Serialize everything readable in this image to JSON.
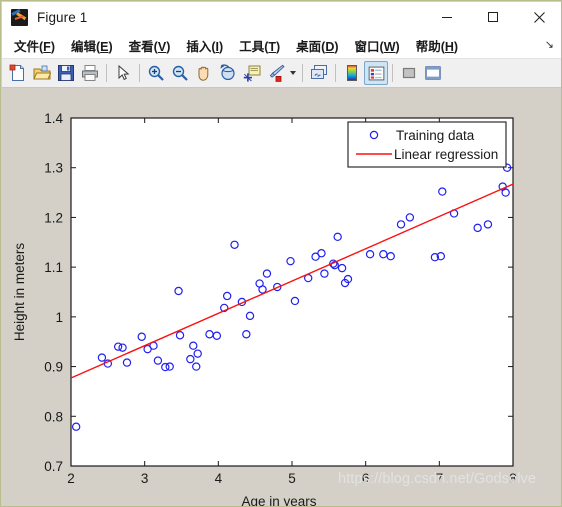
{
  "window": {
    "title": "Figure 1",
    "app_icon": "matlab-icon",
    "controls": {
      "minimize": "minimize-icon",
      "maximize": "maximize-icon",
      "close": "close-icon"
    }
  },
  "menubar": {
    "items": [
      {
        "name": "file",
        "label": "文件(F)",
        "text": "文件(",
        "accel": "F",
        "tail": ")"
      },
      {
        "name": "edit",
        "label": "编辑(E)",
        "text": "编辑(",
        "accel": "E",
        "tail": ")"
      },
      {
        "name": "view",
        "label": "查看(V)",
        "text": "查看(",
        "accel": "V",
        "tail": ")"
      },
      {
        "name": "insert",
        "label": "插入(I)",
        "text": "插入(",
        "accel": "I",
        "tail": ")"
      },
      {
        "name": "tools",
        "label": "工具(T)",
        "text": "工具(",
        "accel": "T",
        "tail": ")"
      },
      {
        "name": "desktop",
        "label": "桌面(D)",
        "text": "桌面(",
        "accel": "D",
        "tail": ")"
      },
      {
        "name": "window",
        "label": "窗口(W)",
        "text": "窗口(",
        "accel": "W",
        "tail": ")"
      },
      {
        "name": "help",
        "label": "帮助(H)",
        "text": "帮助(",
        "accel": "H",
        "tail": ")"
      }
    ],
    "overflow_glyph": "↘"
  },
  "toolbar": {
    "buttons": [
      {
        "name": "new-figure-icon",
        "type": "new"
      },
      {
        "name": "open-file-icon",
        "type": "open"
      },
      {
        "name": "save-figure-icon",
        "type": "save"
      },
      {
        "name": "print-figure-icon",
        "type": "print"
      },
      {
        "name": "separator",
        "type": "sep"
      },
      {
        "name": "pointer-select-icon",
        "type": "pointer"
      },
      {
        "name": "separator",
        "type": "sep"
      },
      {
        "name": "zoom-in-icon",
        "type": "zoomin"
      },
      {
        "name": "zoom-out-icon",
        "type": "zoomout"
      },
      {
        "name": "pan-hand-icon",
        "type": "pan"
      },
      {
        "name": "rotate-3d-icon",
        "type": "rotate"
      },
      {
        "name": "data-cursor-icon",
        "type": "datacursor"
      },
      {
        "name": "brush-data-icon",
        "type": "brush"
      },
      {
        "name": "brush-dropdown-arrow",
        "type": "dropdown"
      },
      {
        "name": "separator",
        "type": "sep"
      },
      {
        "name": "link-plot-icon",
        "type": "link"
      },
      {
        "name": "separator",
        "type": "sep"
      },
      {
        "name": "colorbar-icon",
        "type": "colorbar"
      },
      {
        "name": "legend-icon",
        "type": "legend",
        "pressed": true
      },
      {
        "name": "separator",
        "type": "sep"
      },
      {
        "name": "hide-plot-tools-icon",
        "type": "hidetools"
      },
      {
        "name": "show-plot-tools-icon",
        "type": "showtools"
      }
    ]
  },
  "watermark": "https://blog.csdn.net/Godsolve",
  "chart_data": {
    "type": "scatter",
    "title": "",
    "xlabel": "Age in years",
    "ylabel": "Height in meters",
    "xlim": [
      2,
      8
    ],
    "ylim": [
      0.7,
      1.4
    ],
    "xticks": [
      2,
      3,
      4,
      5,
      6,
      7,
      8
    ],
    "yticks": [
      0.7,
      0.8,
      0.9,
      1,
      1.1,
      1.2,
      1.3,
      1.4
    ],
    "xticklabels": [
      "2",
      "3",
      "4",
      "5",
      "6",
      "7",
      "8"
    ],
    "yticklabels": [
      "0.7",
      "0.8",
      "0.9",
      "1",
      "1.1",
      "1.2",
      "1.3",
      "1.4"
    ],
    "grid": false,
    "legend": {
      "position": "upper-right",
      "entries": [
        {
          "label": "Training data",
          "marker": "circle",
          "color": "#2020ee"
        },
        {
          "label": "Linear regression",
          "marker": "line",
          "color": "#fb1111"
        }
      ]
    },
    "series": [
      {
        "name": "Training data",
        "type": "scatter",
        "marker": "o",
        "color": "#2020ee",
        "points": [
          [
            2.07,
            0.779
          ],
          [
            2.42,
            0.918
          ],
          [
            2.5,
            0.906
          ],
          [
            2.64,
            0.94
          ],
          [
            2.7,
            0.938
          ],
          [
            2.76,
            0.908
          ],
          [
            2.96,
            0.96
          ],
          [
            3.04,
            0.935
          ],
          [
            3.12,
            0.942
          ],
          [
            3.18,
            0.912
          ],
          [
            3.28,
            0.899
          ],
          [
            3.34,
            0.9
          ],
          [
            3.46,
            1.052
          ],
          [
            3.48,
            0.963
          ],
          [
            3.62,
            0.915
          ],
          [
            3.66,
            0.942
          ],
          [
            3.7,
            0.9
          ],
          [
            3.72,
            0.926
          ],
          [
            3.88,
            0.965
          ],
          [
            3.98,
            0.962
          ],
          [
            4.08,
            1.018
          ],
          [
            4.12,
            1.042
          ],
          [
            4.22,
            1.145
          ],
          [
            4.32,
            1.03
          ],
          [
            4.38,
            0.965
          ],
          [
            4.43,
            1.002
          ],
          [
            4.56,
            1.067
          ],
          [
            4.6,
            1.055
          ],
          [
            4.66,
            1.087
          ],
          [
            4.8,
            1.06
          ],
          [
            4.98,
            1.112
          ],
          [
            5.04,
            1.032
          ],
          [
            5.22,
            1.078
          ],
          [
            5.32,
            1.121
          ],
          [
            5.4,
            1.128
          ],
          [
            5.44,
            1.087
          ],
          [
            5.56,
            1.107
          ],
          [
            5.58,
            1.104
          ],
          [
            5.62,
            1.161
          ],
          [
            5.68,
            1.098
          ],
          [
            5.72,
            1.068
          ],
          [
            5.76,
            1.076
          ],
          [
            6.06,
            1.126
          ],
          [
            6.24,
            1.126
          ],
          [
            6.34,
            1.122
          ],
          [
            6.48,
            1.186
          ],
          [
            6.6,
            1.2
          ],
          [
            6.94,
            1.12
          ],
          [
            7.02,
            1.122
          ],
          [
            7.04,
            1.252
          ],
          [
            7.2,
            1.208
          ],
          [
            7.52,
            1.179
          ],
          [
            7.66,
            1.186
          ],
          [
            7.86,
            1.262
          ],
          [
            7.9,
            1.25
          ],
          [
            7.92,
            1.3
          ]
        ]
      },
      {
        "name": "Linear regression",
        "type": "line",
        "color": "#fb1111",
        "x": [
          2,
          8
        ],
        "y": [
          0.877,
          1.267
        ],
        "slope": 0.065,
        "intercept": 0.747
      }
    ]
  }
}
